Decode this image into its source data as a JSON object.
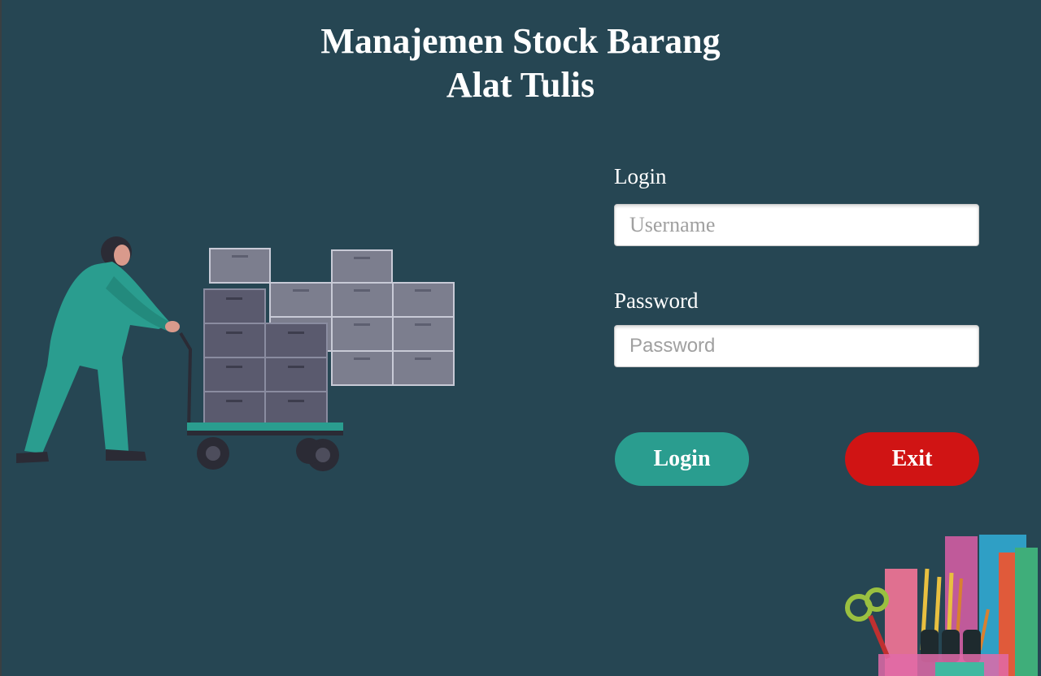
{
  "header": {
    "title_line1": "Manajemen Stock Barang",
    "title_line2": "Alat Tulis"
  },
  "form": {
    "username_label": "Login",
    "username_placeholder": "Username",
    "username_value": "",
    "password_label": "Password",
    "password_placeholder": "Password",
    "password_value": "",
    "login_button": "Login",
    "exit_button": "Exit"
  },
  "colors": {
    "background": "#264653",
    "login": "#2a9d8f",
    "exit": "#d01414"
  },
  "illustrations": [
    "worker-pushing-cart-illustration",
    "stationery-illustration"
  ]
}
